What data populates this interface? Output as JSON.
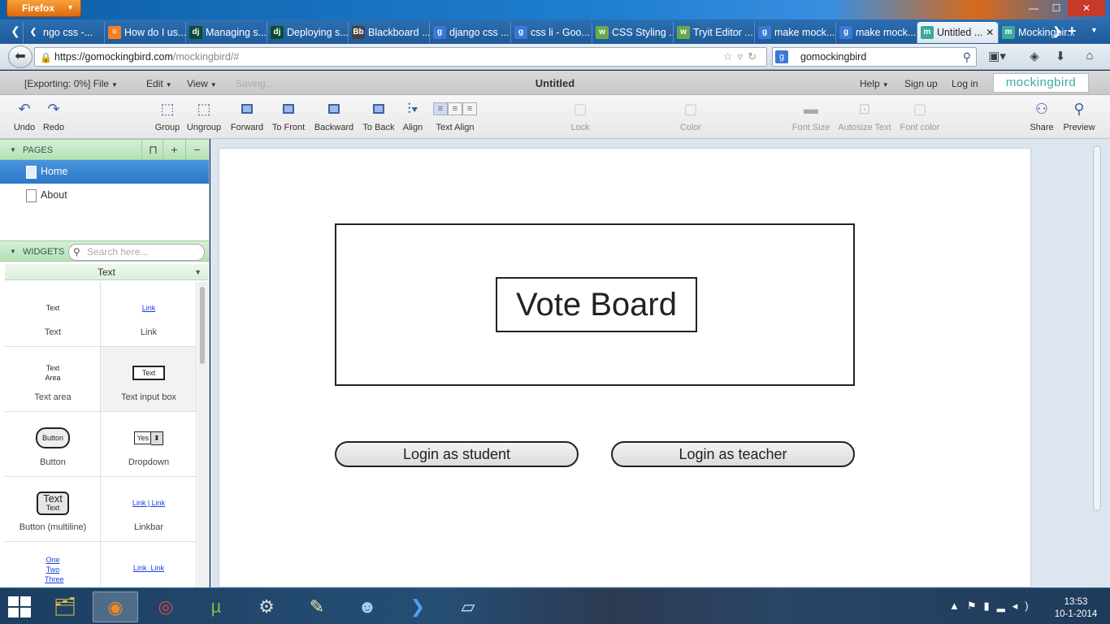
{
  "browser": {
    "menu_button": "Firefox",
    "tabs": [
      {
        "label": "ngo css -...",
        "icon": "chevron-left-icon",
        "color": "#ffffff"
      },
      {
        "label": "How do I us...",
        "icon": "stackoverflow-icon",
        "color": "#f48024"
      },
      {
        "label": "Managing s...",
        "icon": "django-icon",
        "color": "#0c4b33"
      },
      {
        "label": "Deploying s...",
        "icon": "django-icon",
        "color": "#0c4b33"
      },
      {
        "label": "Blackboard ...",
        "icon": "blackboard-icon",
        "color": "#444444"
      },
      {
        "label": "django css ...",
        "icon": "google-icon",
        "color": "#3b78d8"
      },
      {
        "label": "css li - Goo...",
        "icon": "google-icon",
        "color": "#3b78d8"
      },
      {
        "label": "CSS Styling ...",
        "icon": "w3schools-icon",
        "color": "#6aa84f"
      },
      {
        "label": "Tryit Editor ...",
        "icon": "w3schools-icon",
        "color": "#6aa84f"
      },
      {
        "label": "make mock...",
        "icon": "google-icon",
        "color": "#3b78d8"
      },
      {
        "label": "make mock...",
        "icon": "google-icon",
        "color": "#3b78d8"
      },
      {
        "label": "Untitled ...",
        "icon": "mockingbird-icon",
        "color": "#3aab9a",
        "active": true
      },
      {
        "label": "Mockingbir...",
        "icon": "mockingbird-icon",
        "color": "#3aab9a"
      }
    ],
    "url_scheme_host": "https://gomockingbird.com",
    "url_path": "/mockingbird/#",
    "search_value": "gomockingbird"
  },
  "app": {
    "menu": {
      "file": "[Exporting: 0%] File",
      "edit": "Edit",
      "view": "View",
      "status": "Saving...",
      "help": "Help",
      "signup": "Sign up",
      "login": "Log in"
    },
    "doc_title": "Untitled",
    "brand": "mockingbird",
    "toolbar": {
      "undo": "Undo",
      "redo": "Redo",
      "group": "Group",
      "ungroup": "Ungroup",
      "forward": "Forward",
      "to_front": "To Front",
      "backward": "Backward",
      "to_back": "To Back",
      "align": "Align",
      "text_align": "Text Align",
      "lock": "Lock",
      "color": "Color",
      "font_size": "Font Size",
      "autosize": "Autosize Text",
      "font_color": "Font color",
      "share": "Share",
      "preview": "Preview"
    },
    "pages": {
      "header": "PAGES",
      "items": [
        "Home",
        "About"
      ]
    },
    "widgets": {
      "header": "WIDGETS",
      "search_placeholder": "Search here...",
      "category": "Text",
      "items": [
        {
          "label": "Text",
          "preview": "Text"
        },
        {
          "label": "Link",
          "preview": "Link"
        },
        {
          "label": "Text area",
          "preview": "Text Area"
        },
        {
          "label": "Text input box",
          "preview": "Text"
        },
        {
          "label": "Button",
          "preview": "Button"
        },
        {
          "label": "Dropdown",
          "preview": "Yes"
        },
        {
          "label": "Button (multiline)",
          "preview": "Text",
          "preview_sub": "Text"
        },
        {
          "label": "Linkbar",
          "preview": "Link | Link"
        },
        {
          "label": "",
          "preview": "One Two Three"
        },
        {
          "label": "",
          "preview": "Link  Link"
        }
      ]
    },
    "canvas": {
      "title": "Vote Board",
      "buttons": [
        "Login as student",
        "Login as teacher"
      ]
    }
  },
  "taskbar": {
    "apps": [
      "file-explorer-icon",
      "firefox-icon",
      "chrome-icon",
      "utorrent-icon",
      "steam-icon",
      "notepad-icon",
      "app-icon",
      "powershell-icon",
      "notes-icon"
    ],
    "time": "13:53",
    "date": "10-1-2014"
  }
}
